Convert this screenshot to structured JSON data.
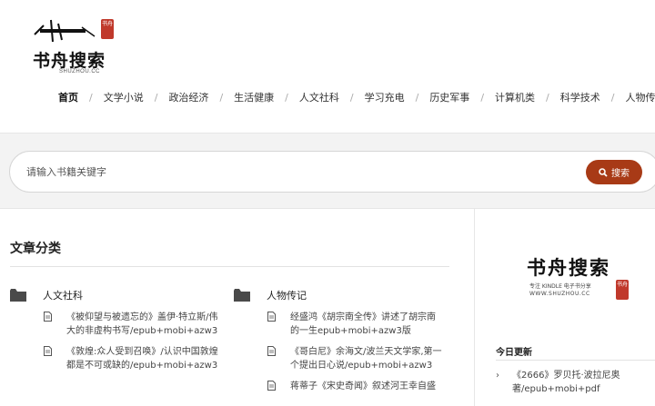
{
  "brand": {
    "name": "书舟搜索",
    "sub": "SHUZHOU.CC",
    "seal": "书舟"
  },
  "nav": [
    {
      "label": "首页",
      "active": true
    },
    {
      "label": "文学小说"
    },
    {
      "label": "政治经济"
    },
    {
      "label": "生活健康"
    },
    {
      "label": "人文社科"
    },
    {
      "label": "学习充电"
    },
    {
      "label": "历史军事"
    },
    {
      "label": "计算机类"
    },
    {
      "label": "科学技术"
    },
    {
      "label": "人物传记"
    }
  ],
  "nav_separator": "/",
  "search": {
    "placeholder": "请输入书籍关键字",
    "button_label": "搜索"
  },
  "main": {
    "section_title": "文章分类",
    "categories": [
      {
        "name": "人文社科",
        "posts": [
          {
            "title": "《被仰望与被遗忘的》盖伊·特立斯/伟大的非虚构书写/epub+mobi+azw3"
          },
          {
            "title": "《敦煌:众人受到召唤》/认识中国敦煌都是不可或缺的/epub+mobi+azw3"
          }
        ]
      },
      {
        "name": "人物传记",
        "posts": [
          {
            "title": "经盛鸿《胡宗南全传》讲述了胡宗南的一生epub+mobi+azw3版"
          },
          {
            "title": "《哥白尼》余海文/波兰天文学家,第一个提出日心说/epub+mobi+azw3"
          },
          {
            "title": "蒋蒂子《宋史奇闻》叙述河王幸自盛"
          }
        ]
      }
    ]
  },
  "sidebar": {
    "logo_text": "书舟搜索",
    "tagline": "专注 KINDLE 电子书分享",
    "url": "WWW.SHUZHOU.CC",
    "seal": "书舟",
    "section_title": "今日更新",
    "items": [
      {
        "title": "《2666》罗贝托·波拉尼奥著/epub+mobi+pdf"
      }
    ]
  },
  "colors": {
    "accent": "#a83a16",
    "seal": "#c0392b",
    "band": "#f3f3f3"
  },
  "icons": {
    "folder": "folder-icon",
    "document": "document-icon",
    "search": "search-icon",
    "chevron": "chevron-right-icon"
  }
}
